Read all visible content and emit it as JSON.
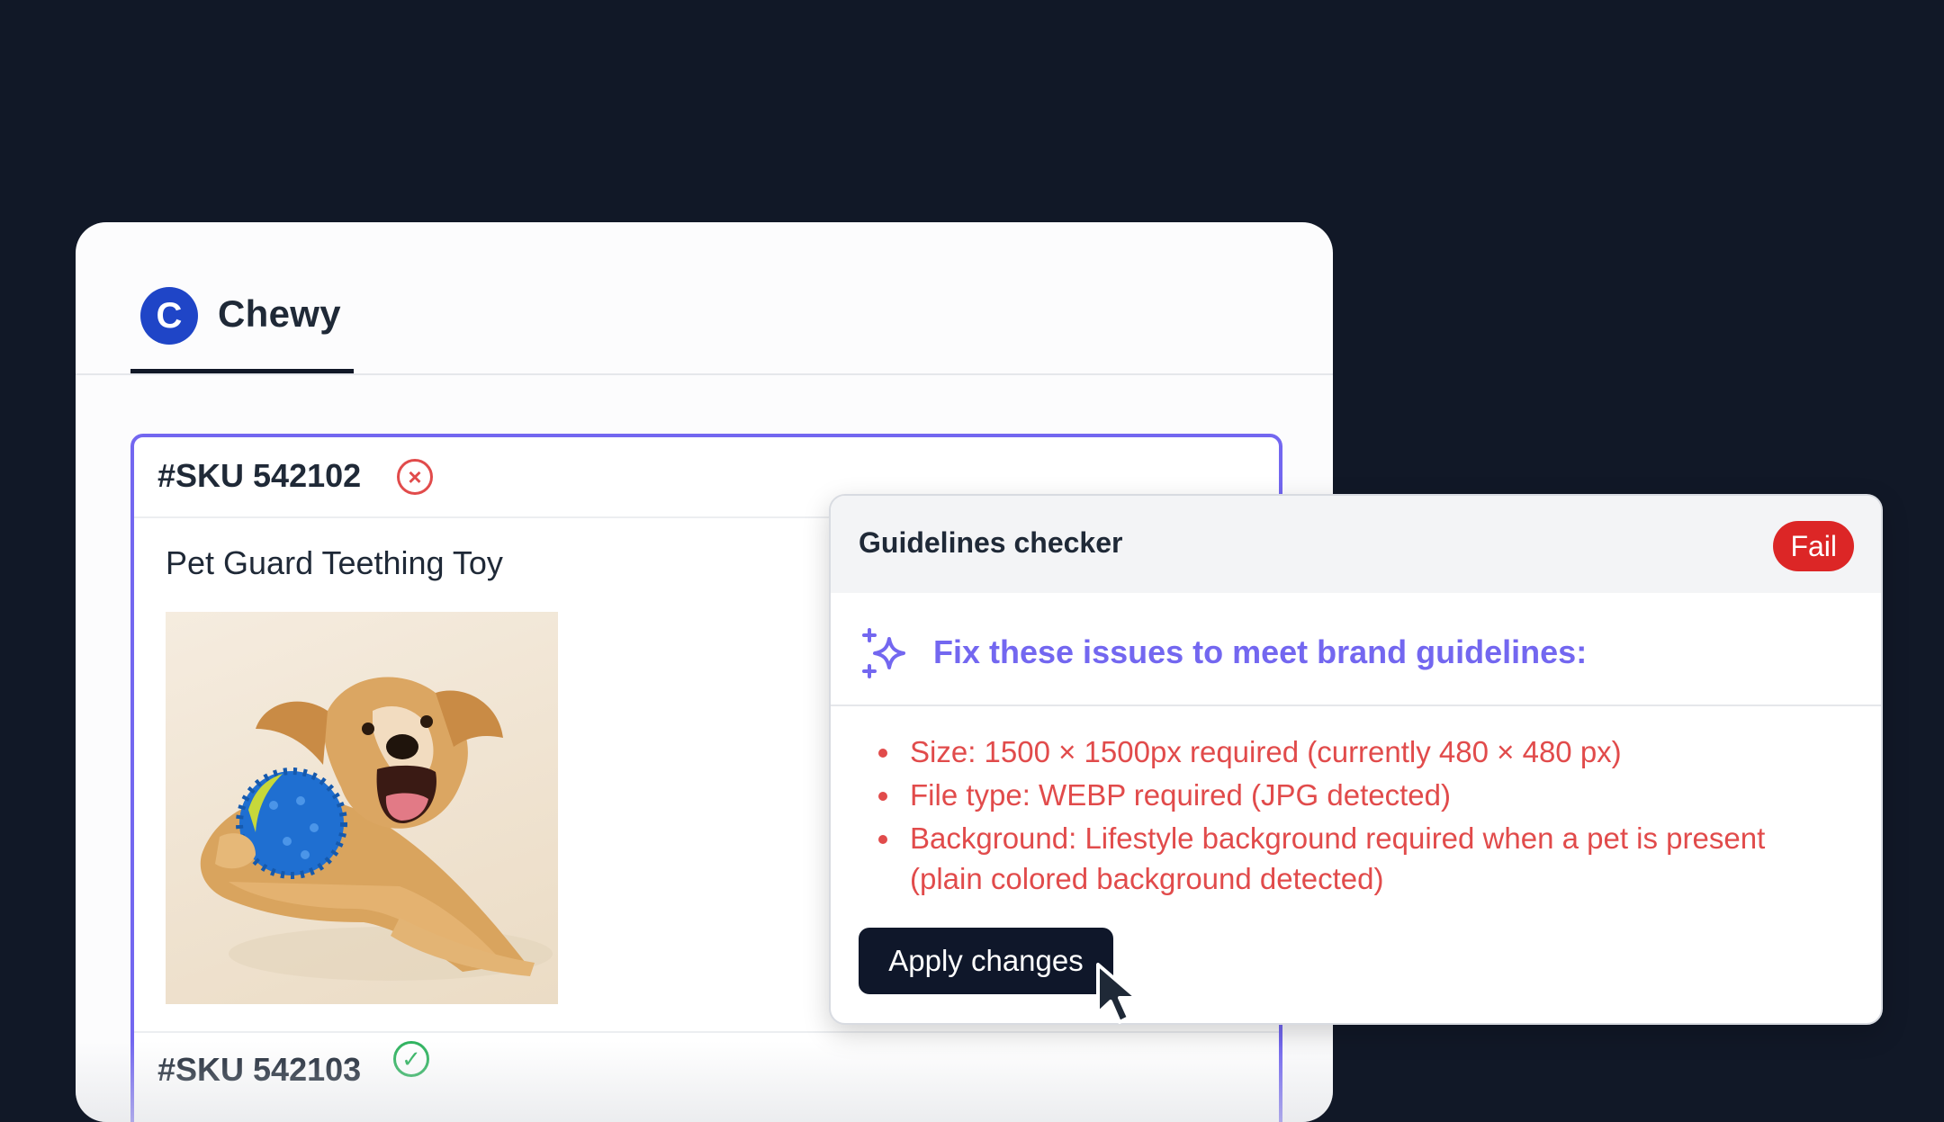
{
  "brand": {
    "logo_letter": "C",
    "name": "Chewy"
  },
  "sku_items": [
    {
      "id": "#SKU 542102",
      "status": "fail",
      "status_symbol": "×",
      "product_name": "Pet Guard Teething Toy",
      "image": "golden-retriever-with-blue-ball"
    },
    {
      "id": "#SKU 542103",
      "status": "pass",
      "status_symbol": "✓"
    }
  ],
  "checker": {
    "title": "Guidelines checker",
    "badge": "Fail",
    "fix_title": "Fix these issues to meet brand guidelines:",
    "issues": [
      "Size: 1500 × 1500px required (currently 480 × 480 px)",
      "File type: WEBP required (JPG detected)",
      "Background: Lifestyle background required when a pet is present (plain colored background detected)"
    ],
    "apply_label": "Apply changes"
  },
  "colors": {
    "background": "#111827",
    "accent": "#7367f0",
    "brand_blue": "#1f45c7",
    "fail_red": "#dc2626",
    "issue_red": "#e14b4b",
    "pass_green": "#2fb35f"
  }
}
